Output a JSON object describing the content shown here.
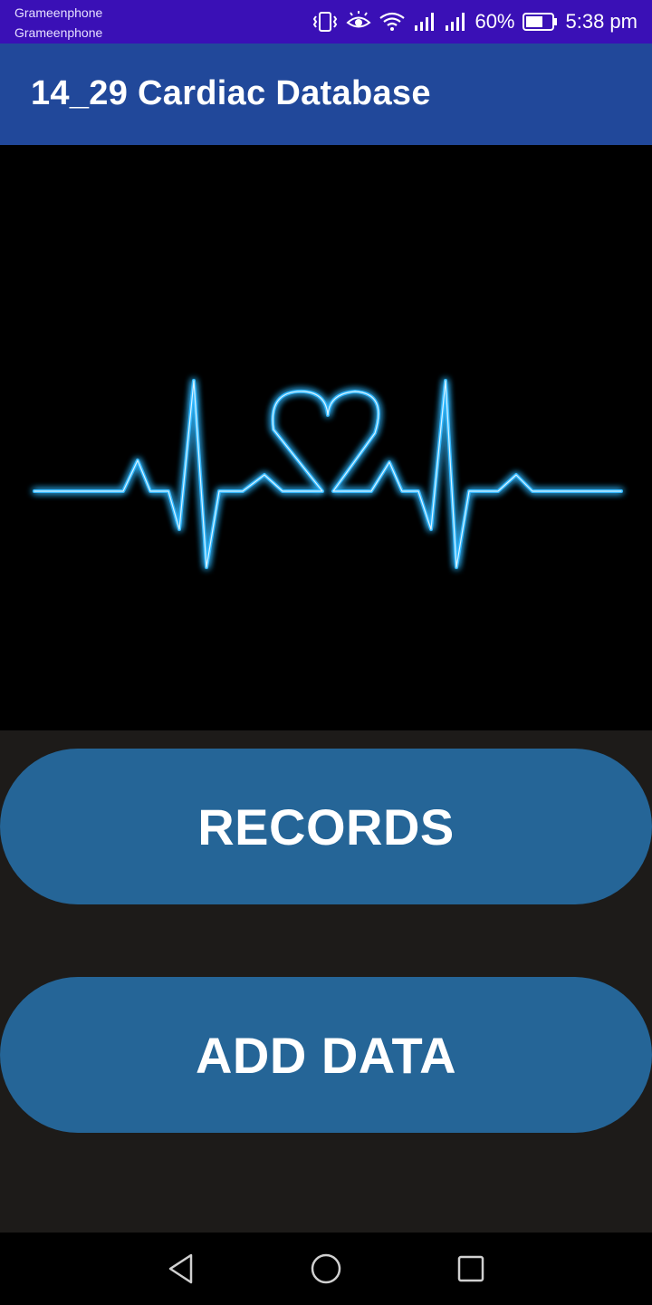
{
  "status_bar": {
    "carrier_1": "Grameenphone",
    "carrier_2": "Grameenphone",
    "battery_percent": "60%",
    "time": "5:38 pm",
    "icons": [
      "vibrate-icon",
      "eye-comfort-icon",
      "wifi-icon",
      "signal-icon",
      "signal-icon",
      "battery-icon"
    ]
  },
  "app_bar": {
    "title": "14_29 Cardiac Database"
  },
  "hero": {
    "image": "heartbeat-line-with-heart-graphic",
    "line_color": "#31b8ff"
  },
  "buttons": {
    "records_label": "RECORDS",
    "add_data_label": "ADD DATA"
  },
  "nav_bar": {
    "icons": [
      "back-icon",
      "home-icon",
      "recent-apps-icon"
    ]
  },
  "colors": {
    "status_bar": "#3a10b6",
    "app_bar": "#21489a",
    "button": "#256597",
    "background": "#1d1b19"
  }
}
